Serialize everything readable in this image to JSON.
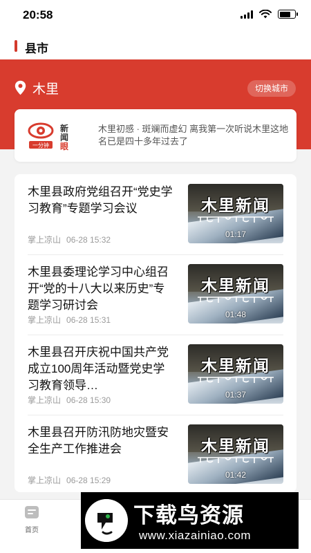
{
  "status_bar": {
    "time": "20:58"
  },
  "header": {
    "title": "县市"
  },
  "location": {
    "name": "木里",
    "switch_label": "切换城市"
  },
  "promo": {
    "logo_text": "新闻眼",
    "logo_sub": "一分钟",
    "text": "木里初感 · 斑斓而虚幻  离我第一次听说木里这地名已是四十多年过去了"
  },
  "news": [
    {
      "title": "木里县政府党组召开“党史学习教育”专题学习会议",
      "source": "掌上凉山",
      "time": "06-28 15:32",
      "thumb_title": "木里新闻",
      "duration": "01:17"
    },
    {
      "title": "木里县委理论学习中心组召开“党的十八大以来历史”专题学习研讨会",
      "source": "掌上凉山",
      "time": "06-28 15:31",
      "thumb_title": "木里新闻",
      "duration": "01:48"
    },
    {
      "title": "木里县召开庆祝中国共产党成立100周年活动暨党史学习教育领导…",
      "source": "掌上凉山",
      "time": "06-28 15:30",
      "thumb_title": "木里新闻",
      "duration": "01:37"
    },
    {
      "title": "木里县召开防汛防地灾暨安全生产工作推进会",
      "source": "掌上凉山",
      "time": "06-28 15:29",
      "thumb_title": "木里新闻",
      "duration": "01:42"
    }
  ],
  "tabbar": {
    "home_label": "首页"
  },
  "watermark": {
    "text": "下载鸟资源",
    "url": "www.xiazainiao.com"
  },
  "colors": {
    "accent": "#d83c2e",
    "meta": "#9a9a9a"
  }
}
